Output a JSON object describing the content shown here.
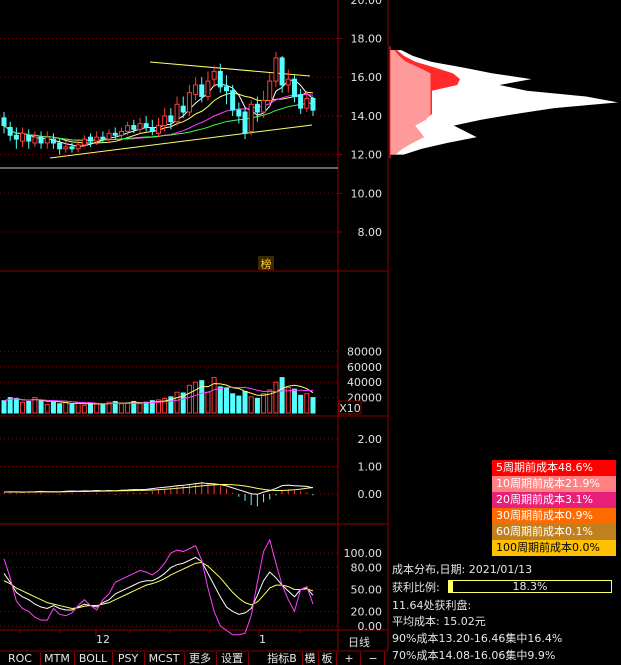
{
  "price_axis": [
    "20.00",
    "18.00",
    "16.00",
    "14.00",
    "12.00",
    "10.00",
    "8.00"
  ],
  "volume_axis": [
    "80000",
    "60000",
    "40000",
    "20000"
  ],
  "volume_unit": "X10",
  "macd_axis": [
    "2.00",
    "1.00",
    "0.00"
  ],
  "kd_axis": [
    "100.00",
    "80.00",
    "50.00",
    "20.00",
    "0.00"
  ],
  "bang_label": "榜",
  "x_labels": [
    "12",
    "1"
  ],
  "period_label": "日线",
  "legend": [
    {
      "text": "5周期前成本48.6%",
      "bg": "#ff0000",
      "fg": "#ffffff"
    },
    {
      "text": "10周期前成本21.9%",
      "bg": "#ff8080",
      "fg": "#ffffff"
    },
    {
      "text": "20周期前成本3.1%",
      "bg": "#e8207a",
      "fg": "#ffffff"
    },
    {
      "text": "30周期前成本0.9%",
      "bg": "#ff6a00",
      "fg": "#ffffff"
    },
    {
      "text": "60周期前成本0.1%",
      "bg": "#c08020",
      "fg": "#ffffff"
    },
    {
      "text": "100周期前成本0.0%",
      "bg": "#ffc000",
      "fg": "#000000"
    }
  ],
  "chip": {
    "date_label": "成本分布,日期: ",
    "date": "2021/01/13",
    "profit_label": "获利比例:",
    "profit_ratio": "18.3%",
    "profit_fraction": 0.183,
    "profit_line": "11.64处获利盘:",
    "avg_cost": "平均成本: 15.02元",
    "cost90": "90%成本13.20-16.46集中16.4%",
    "cost70": "70%成本14.08-16.06集中9.9%"
  },
  "tabs": [
    "ROC",
    "MTM",
    "BOLL",
    "PSY",
    "MCST",
    "更多",
    "设置",
    "指标B",
    "模",
    "板",
    "+",
    "−"
  ],
  "colors": {
    "grid": "#8a0000",
    "up": "#ff3b3b",
    "down": "#54ffff",
    "ma1": "#ffffff",
    "ma2": "#ffff66",
    "ma3": "#ff40ff",
    "ma4": "#40ff40"
  },
  "chart_data": {
    "type": "candlestick",
    "ylim": [
      7.0,
      20.0
    ],
    "candles": [
      {
        "o": 13.9,
        "c": 13.5,
        "h": 14.2,
        "l": 13.1
      },
      {
        "o": 13.4,
        "c": 13.0,
        "h": 13.7,
        "l": 12.7
      },
      {
        "o": 13.0,
        "c": 12.8,
        "h": 13.4,
        "l": 12.3
      },
      {
        "o": 12.7,
        "c": 13.1,
        "h": 13.4,
        "l": 12.4
      },
      {
        "o": 13.0,
        "c": 12.7,
        "h": 13.3,
        "l": 12.3
      },
      {
        "o": 12.6,
        "c": 12.9,
        "h": 13.2,
        "l": 12.4
      },
      {
        "o": 12.9,
        "c": 12.6,
        "h": 13.2,
        "l": 12.3
      },
      {
        "o": 12.6,
        "c": 12.9,
        "h": 13.2,
        "l": 12.3
      },
      {
        "o": 12.8,
        "c": 12.6,
        "h": 13.1,
        "l": 12.3
      },
      {
        "o": 12.6,
        "c": 12.3,
        "h": 12.8,
        "l": 12.0
      },
      {
        "o": 12.3,
        "c": 12.4,
        "h": 12.7,
        "l": 12.1
      },
      {
        "o": 12.4,
        "c": 12.3,
        "h": 12.6,
        "l": 12.1
      },
      {
        "o": 12.3,
        "c": 12.5,
        "h": 12.8,
        "l": 12.1
      },
      {
        "o": 12.5,
        "c": 12.8,
        "h": 13.0,
        "l": 12.4
      },
      {
        "o": 12.9,
        "c": 12.7,
        "h": 13.1,
        "l": 12.4
      },
      {
        "o": 12.7,
        "c": 12.9,
        "h": 13.2,
        "l": 12.5
      },
      {
        "o": 12.9,
        "c": 12.8,
        "h": 13.2,
        "l": 12.6
      },
      {
        "o": 12.8,
        "c": 13.1,
        "h": 13.3,
        "l": 12.6
      },
      {
        "o": 13.1,
        "c": 13.0,
        "h": 13.4,
        "l": 12.8
      },
      {
        "o": 13.0,
        "c": 13.2,
        "h": 13.4,
        "l": 12.8
      },
      {
        "o": 13.2,
        "c": 13.5,
        "h": 13.7,
        "l": 13.0
      },
      {
        "o": 13.5,
        "c": 13.3,
        "h": 13.8,
        "l": 13.1
      },
      {
        "o": 13.3,
        "c": 13.6,
        "h": 13.9,
        "l": 13.1
      },
      {
        "o": 13.6,
        "c": 13.4,
        "h": 14.0,
        "l": 13.2
      },
      {
        "o": 13.4,
        "c": 13.2,
        "h": 13.8,
        "l": 13.0
      },
      {
        "o": 13.1,
        "c": 13.5,
        "h": 13.9,
        "l": 12.9
      },
      {
        "o": 13.5,
        "c": 14.0,
        "h": 14.4,
        "l": 13.2
      },
      {
        "o": 14.0,
        "c": 13.7,
        "h": 14.4,
        "l": 13.3
      },
      {
        "o": 13.7,
        "c": 14.6,
        "h": 15.0,
        "l": 13.5
      },
      {
        "o": 14.5,
        "c": 14.2,
        "h": 15.0,
        "l": 13.9
      },
      {
        "o": 14.2,
        "c": 15.2,
        "h": 15.6,
        "l": 14.0
      },
      {
        "o": 15.1,
        "c": 15.6,
        "h": 16.0,
        "l": 14.8
      },
      {
        "o": 15.6,
        "c": 15.0,
        "h": 16.0,
        "l": 14.7
      },
      {
        "o": 15.0,
        "c": 15.8,
        "h": 16.3,
        "l": 14.8
      },
      {
        "o": 15.9,
        "c": 16.3,
        "h": 16.6,
        "l": 15.5
      },
      {
        "o": 16.3,
        "c": 15.5,
        "h": 16.7,
        "l": 15.2
      },
      {
        "o": 15.5,
        "c": 15.3,
        "h": 16.1,
        "l": 14.6
      },
      {
        "o": 15.3,
        "c": 14.3,
        "h": 15.6,
        "l": 14.0
      },
      {
        "o": 14.3,
        "c": 14.0,
        "h": 14.7,
        "l": 13.6
      },
      {
        "o": 14.2,
        "c": 13.1,
        "h": 14.4,
        "l": 12.8
      },
      {
        "o": 13.2,
        "c": 14.6,
        "h": 14.8,
        "l": 13.0
      },
      {
        "o": 14.6,
        "c": 14.2,
        "h": 15.0,
        "l": 13.7
      },
      {
        "o": 14.2,
        "c": 14.8,
        "h": 15.3,
        "l": 13.9
      },
      {
        "o": 14.8,
        "c": 15.8,
        "h": 16.2,
        "l": 14.5
      },
      {
        "o": 15.8,
        "c": 17.0,
        "h": 17.3,
        "l": 15.5
      },
      {
        "o": 17.0,
        "c": 15.6,
        "h": 17.1,
        "l": 15.2
      },
      {
        "o": 15.6,
        "c": 15.9,
        "h": 16.4,
        "l": 15.2
      },
      {
        "o": 15.9,
        "c": 15.0,
        "h": 16.1,
        "l": 14.7
      },
      {
        "o": 15.1,
        "c": 14.4,
        "h": 15.4,
        "l": 14.1
      },
      {
        "o": 14.4,
        "c": 14.9,
        "h": 15.3,
        "l": 14.2
      },
      {
        "o": 14.9,
        "c": 14.3,
        "h": 15.0,
        "l": 14.0
      }
    ],
    "volume": [
      16,
      20,
      19,
      14,
      15,
      20,
      16,
      11,
      14,
      12,
      14,
      11,
      13,
      10,
      13,
      12,
      11,
      14,
      15,
      12,
      13,
      15,
      12,
      14,
      16,
      17,
      19,
      21,
      27,
      26,
      36,
      40,
      42,
      27,
      46,
      34,
      32,
      25,
      22,
      28,
      21,
      19,
      25,
      30,
      40,
      46,
      33,
      31,
      23,
      25,
      20
    ],
    "macd": [
      0.05,
      0.05,
      0.03,
      0.0,
      0.02,
      0.02,
      0.04,
      0.01,
      0.0,
      -0.02,
      0.02,
      0.03,
      0.0,
      0.02,
      0.01,
      0.03,
      0.0,
      0.02,
      -0.02,
      0.02,
      0.03,
      0.05,
      0.04,
      0.05,
      0.1,
      0.15,
      0.18,
      0.22,
      0.28,
      0.3,
      0.35,
      0.4,
      0.45,
      0.4,
      0.36,
      0.3,
      0.2,
      0.05,
      -0.1,
      -0.25,
      -0.4,
      -0.45,
      -0.3,
      -0.2,
      -0.05,
      0.15,
      0.18,
      0.12,
      0.1,
      0.06,
      -0.05
    ],
    "k": [
      72,
      60,
      46,
      40,
      36,
      30,
      26,
      24,
      28,
      24,
      22,
      22,
      26,
      30,
      28,
      26,
      32,
      36,
      44,
      48,
      52,
      56,
      60,
      62,
      62,
      66,
      72,
      80,
      84,
      86,
      90,
      94,
      88,
      72,
      56,
      40,
      26,
      20,
      16,
      18,
      24,
      42,
      62,
      74,
      66,
      56,
      48,
      40,
      50,
      52,
      42
    ],
    "d": [
      62,
      58,
      52,
      48,
      44,
      40,
      36,
      32,
      30,
      28,
      26,
      24,
      25,
      27,
      28,
      28,
      30,
      32,
      36,
      40,
      44,
      48,
      52,
      56,
      58,
      61,
      65,
      70,
      74,
      78,
      82,
      86,
      87,
      82,
      74,
      66,
      56,
      46,
      38,
      32,
      29,
      33,
      42,
      52,
      56,
      56,
      54,
      50,
      50,
      51,
      48
    ],
    "j": [
      92,
      66,
      34,
      24,
      20,
      12,
      8,
      8,
      24,
      16,
      14,
      18,
      28,
      36,
      28,
      22,
      36,
      44,
      60,
      64,
      68,
      72,
      76,
      74,
      70,
      76,
      86,
      100,
      104,
      102,
      106,
      110,
      90,
      52,
      20,
      0,
      -6,
      -12,
      -12,
      -10,
      14,
      60,
      102,
      118,
      86,
      56,
      36,
      20,
      50,
      54,
      30
    ],
    "chip_profile": [
      {
        "p": 12.0,
        "a": 0.06
      },
      {
        "p": 12.3,
        "a": 0.14
      },
      {
        "p": 12.6,
        "a": 0.25
      },
      {
        "p": 12.9,
        "a": 0.38
      },
      {
        "p": 13.2,
        "a": 0.33
      },
      {
        "p": 13.5,
        "a": 0.28
      },
      {
        "p": 13.8,
        "a": 0.4
      },
      {
        "p": 14.1,
        "a": 0.55
      },
      {
        "p": 14.4,
        "a": 0.72
      },
      {
        "p": 14.7,
        "a": 1.0
      },
      {
        "p": 15.0,
        "a": 0.86
      },
      {
        "p": 15.3,
        "a": 0.6
      },
      {
        "p": 15.6,
        "a": 0.48
      },
      {
        "p": 15.9,
        "a": 0.62
      },
      {
        "p": 16.2,
        "a": 0.45
      },
      {
        "p": 16.5,
        "a": 0.32
      },
      {
        "p": 16.8,
        "a": 0.18
      },
      {
        "p": 17.1,
        "a": 0.1
      },
      {
        "p": 17.4,
        "a": 0.05
      }
    ]
  }
}
